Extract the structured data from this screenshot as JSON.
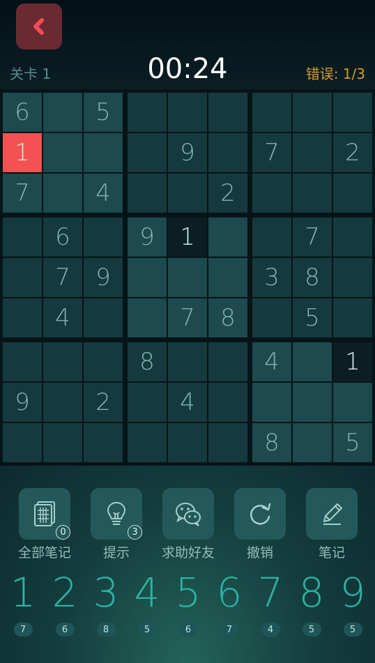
{
  "header": {
    "level_text": "关卡 1",
    "timer": "00:24",
    "mistakes_text": "错误: 1/3"
  },
  "board": {
    "rows": [
      [
        "6",
        "",
        "5",
        "",
        "",
        "",
        "",
        "",
        ""
      ],
      [
        "1",
        "",
        "",
        "",
        "9",
        "",
        "7",
        "",
        "2"
      ],
      [
        "7",
        "",
        "4",
        "",
        "",
        "2",
        "",
        "",
        ""
      ],
      [
        "",
        "6",
        "",
        "9",
        "1",
        "",
        "",
        "7",
        ""
      ],
      [
        "",
        "7",
        "9",
        "",
        "",
        "",
        "3",
        "8",
        ""
      ],
      [
        "",
        "4",
        "",
        "",
        "7",
        "8",
        "",
        "5",
        ""
      ],
      [
        "",
        "",
        "",
        "8",
        "",
        "",
        "4",
        "",
        "1"
      ],
      [
        "9",
        "",
        "2",
        "",
        "4",
        "",
        "",
        "",
        ""
      ],
      [
        "",
        "",
        "",
        "",
        "",
        "",
        "8",
        "",
        "5"
      ]
    ],
    "error_cell": "r2c1",
    "selected_cells": [
      "r4c5",
      "r7c9"
    ]
  },
  "actions": [
    {
      "id": "all-notes",
      "label": "全部笔记",
      "badge": "0",
      "icon": "notes-grid-icon"
    },
    {
      "id": "hint",
      "label": "提示",
      "badge": "3",
      "icon": "lightbulb-icon"
    },
    {
      "id": "ask-friend",
      "label": "求助好友",
      "badge": "",
      "icon": "wechat-icon"
    },
    {
      "id": "undo",
      "label": "撤销",
      "badge": "",
      "icon": "undo-icon"
    },
    {
      "id": "notes",
      "label": "笔记",
      "badge": "",
      "icon": "pencil-icon"
    }
  ],
  "numpad": [
    {
      "digit": "1",
      "remaining": "7"
    },
    {
      "digit": "2",
      "remaining": "6"
    },
    {
      "digit": "3",
      "remaining": "8"
    },
    {
      "digit": "4",
      "remaining": "5"
    },
    {
      "digit": "5",
      "remaining": "6"
    },
    {
      "digit": "6",
      "remaining": "7"
    },
    {
      "digit": "7",
      "remaining": "4"
    },
    {
      "digit": "8",
      "remaining": "5"
    },
    {
      "digit": "9",
      "remaining": "5"
    }
  ],
  "colors": {
    "accent_digit": "#2bb3a4",
    "error_cell": "#f25252",
    "mistakes_text": "#d89a2a",
    "back_button": "#6a2a31"
  }
}
